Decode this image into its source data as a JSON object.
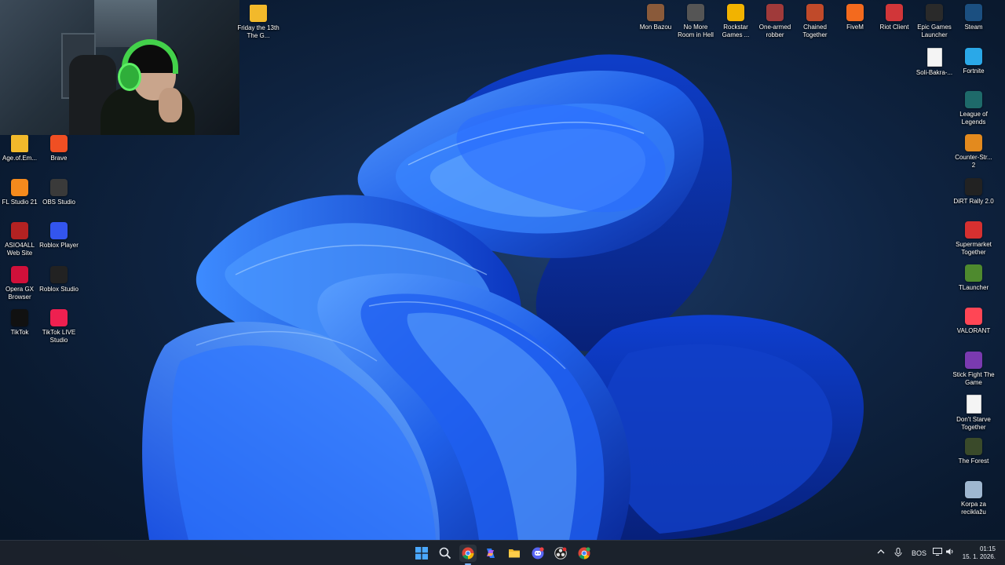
{
  "desktop": {
    "left_icons": [
      {
        "label": "Age.of.Em...",
        "icon": "folder-icon",
        "color": "#f2b92b"
      },
      {
        "label": "Brave",
        "icon": "brave-icon",
        "color": "#f04f23"
      },
      {
        "label": "FL Studio 21",
        "icon": "fl-studio-icon",
        "color": "#f48a1d"
      },
      {
        "label": "OBS Studio",
        "icon": "obs-icon",
        "color": "#3a3a3a"
      },
      {
        "label": "ASIO4ALL Web Site",
        "icon": "asio-icon",
        "color": "#b32222"
      },
      {
        "label": "Roblox Player",
        "icon": "roblox-player-icon",
        "color": "#3355ee"
      },
      {
        "label": "Opera GX Browser",
        "icon": "opera-gx-icon",
        "color": "#d0103a"
      },
      {
        "label": "Roblox Studio",
        "icon": "roblox-studio-icon",
        "color": "#222222"
      },
      {
        "label": "TikTok",
        "icon": "tiktok-icon",
        "color": "#111111"
      },
      {
        "label": "TikTok LIVE Studio",
        "icon": "tiktok-live-icon",
        "color": "#ee2050"
      }
    ],
    "friday": {
      "label": "Friday the 13th The G...",
      "icon": "folder-icon",
      "color": "#f2b92b"
    },
    "top_icons": [
      {
        "label": "Mon Bazou",
        "icon": "mon-bazou-icon",
        "color": "#8a5a3a"
      },
      {
        "label": "No More Room in Hell",
        "icon": "nmrih-icon",
        "color": "#555555"
      },
      {
        "label": "Rockstar Games ...",
        "icon": "rockstar-icon",
        "color": "#f2b300"
      },
      {
        "label": "One-armed robber",
        "icon": "one-armed-robber-icon",
        "color": "#a03a3a"
      },
      {
        "label": "Chained Together",
        "icon": "chained-together-icon",
        "color": "#c04a2a"
      },
      {
        "label": "FiveM",
        "icon": "fivem-icon",
        "color": "#f36a1e"
      },
      {
        "label": "Riot Client",
        "icon": "riot-client-icon",
        "color": "#d13639"
      },
      {
        "label": "Epic Games Launcher",
        "icon": "epic-games-icon",
        "color": "#2a2a2a"
      },
      {
        "label": "Steam",
        "icon": "steam-icon",
        "color": "#1b4f80"
      }
    ],
    "right_icons": [
      {
        "label": "Soli-Bakra-...",
        "icon": "document-icon",
        "color": "#f4f4f4"
      },
      {
        "label": "Fortnite",
        "icon": "fortnite-icon",
        "color": "#2aa8e8"
      },
      {
        "label": "League of Legends",
        "icon": "league-icon",
        "color": "#1e6a6a"
      },
      {
        "label": "Counter-Str... 2",
        "icon": "counter-strike-icon",
        "color": "#e38a1e"
      },
      {
        "label": "DiRT Rally 2.0",
        "icon": "dirt-rally-icon",
        "color": "#222222"
      },
      {
        "label": "Supermarket Together",
        "icon": "supermarket-icon",
        "color": "#d63030"
      },
      {
        "label": "TLauncher",
        "icon": "tlauncher-icon",
        "color": "#4e8a2e"
      },
      {
        "label": "VALORANT",
        "icon": "valorant-icon",
        "color": "#ff4655"
      },
      {
        "label": "Stick Fight The Game",
        "icon": "stick-fight-icon",
        "color": "#7a3ab0"
      },
      {
        "label": "Don't Starve Together",
        "icon": "document-icon",
        "color": "#f4f4f4"
      },
      {
        "label": "The Forest",
        "icon": "the-forest-icon",
        "color": "#3a4a2a"
      },
      {
        "label": "Korpa za reciklažu",
        "icon": "recycle-bin-icon",
        "color": "#9fb7d0"
      }
    ]
  },
  "taskbar": {
    "apps": [
      {
        "name": "start-button",
        "icon": "windows-icon"
      },
      {
        "name": "search-button",
        "icon": "search-icon"
      },
      {
        "name": "chrome-taskbar",
        "icon": "chrome-icon",
        "active": true
      },
      {
        "name": "copilot-taskbar",
        "icon": "copilot-icon"
      },
      {
        "name": "file-explorer-taskbar",
        "icon": "folder-icon"
      },
      {
        "name": "discord-taskbar",
        "icon": "discord-icon"
      },
      {
        "name": "obs-taskbar",
        "icon": "obs-icon"
      },
      {
        "name": "chrome-profile-taskbar",
        "icon": "chrome-icon"
      }
    ],
    "tray": {
      "language": "BOS",
      "time": "01:15",
      "date": "15. 1. 2026."
    }
  },
  "colors": {
    "accent": "#3b7bff",
    "taskbar_bg": "#1c222c"
  }
}
